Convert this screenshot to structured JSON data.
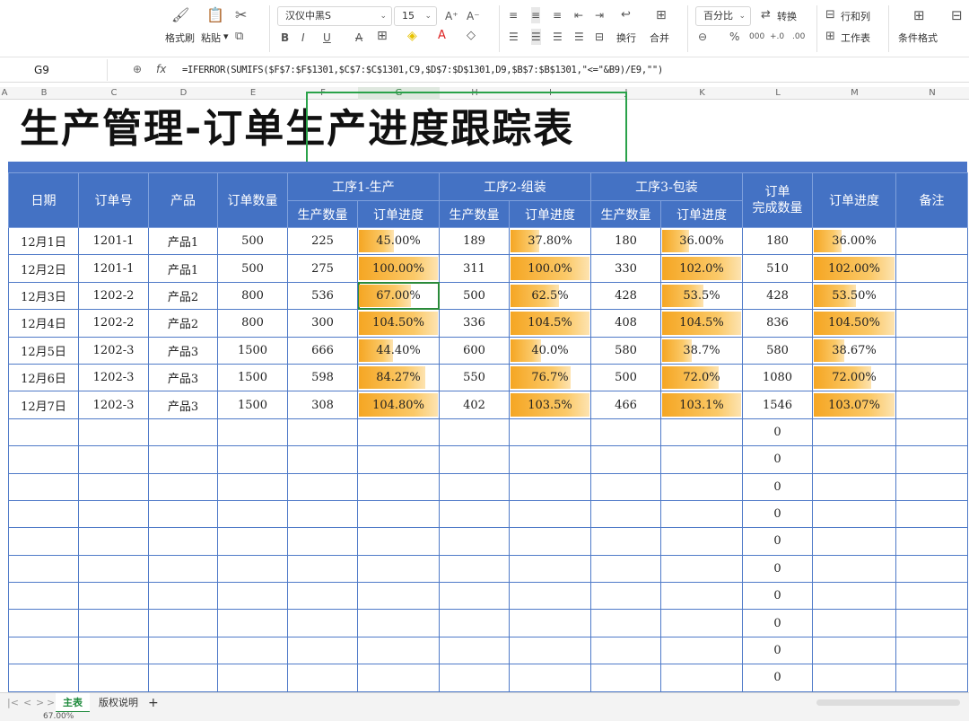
{
  "toolbar": {
    "format_painter": "格式刷",
    "paste": "粘贴",
    "font_name": "汉仪中黑S",
    "font_size": "15",
    "number_format": "百分比",
    "convert": "转换",
    "rows_cols": "行和列",
    "wrap": "换行",
    "merge": "合并",
    "worksheet": "工作表",
    "cond_format": "条件格式"
  },
  "formula_bar": {
    "cell": "G9",
    "fx": "fx",
    "formula": "=IFERROR(SUMIFS($F$7:$F$1301,$C$7:$C$1301,C9,$D$7:$D$1301,D9,$B$7:$B$1301,\"<=\"&B9)/E9,\"\")"
  },
  "columns": [
    "A",
    "B",
    "C",
    "D",
    "E",
    "F",
    "G",
    "H",
    "I",
    "J",
    "K",
    "L",
    "M",
    "N"
  ],
  "title": "生产管理-订单生产进度跟踪表",
  "header": {
    "date": "日期",
    "order_no": "订单号",
    "product": "产品",
    "order_qty": "订单数量",
    "proc1": "工序1-生产",
    "proc2": "工序2-组装",
    "proc3": "工序3-包装",
    "qty": "生产数量",
    "progress": "订单进度",
    "done_qty": "订单\n完成数量",
    "order_progress": "订单进度",
    "remark": "备注"
  },
  "rows": [
    {
      "date": "12月1日",
      "order": "1201-1",
      "product": "产品1",
      "qty": "500",
      "p1q": "225",
      "p1p": "45.00%",
      "p1v": 0.45,
      "p2q": "189",
      "p2p": "37.80%",
      "p2v": 0.378,
      "p3q": "180",
      "p3p": "36.00%",
      "p3v": 0.36,
      "done": "180",
      "op": "36.00%",
      "opv": 0.36
    },
    {
      "date": "12月2日",
      "order": "1201-1",
      "product": "产品1",
      "qty": "500",
      "p1q": "275",
      "p1p": "100.00%",
      "p1v": 1.0,
      "p2q": "311",
      "p2p": "100.0%",
      "p2v": 1.0,
      "p3q": "330",
      "p3p": "102.0%",
      "p3v": 1.02,
      "done": "510",
      "op": "102.00%",
      "opv": 1.02
    },
    {
      "date": "12月3日",
      "order": "1202-2",
      "product": "产品2",
      "qty": "800",
      "p1q": "536",
      "p1p": "67.00%",
      "p1v": 0.67,
      "p2q": "500",
      "p2p": "62.5%",
      "p2v": 0.625,
      "p3q": "428",
      "p3p": "53.5%",
      "p3v": 0.535,
      "done": "428",
      "op": "53.50%",
      "opv": 0.535
    },
    {
      "date": "12月4日",
      "order": "1202-2",
      "product": "产品2",
      "qty": "800",
      "p1q": "300",
      "p1p": "104.50%",
      "p1v": 1.045,
      "p2q": "336",
      "p2p": "104.5%",
      "p2v": 1.045,
      "p3q": "408",
      "p3p": "104.5%",
      "p3v": 1.045,
      "done": "836",
      "op": "104.50%",
      "opv": 1.045
    },
    {
      "date": "12月5日",
      "order": "1202-3",
      "product": "产品3",
      "qty": "1500",
      "p1q": "666",
      "p1p": "44.40%",
      "p1v": 0.444,
      "p2q": "600",
      "p2p": "40.0%",
      "p2v": 0.4,
      "p3q": "580",
      "p3p": "38.7%",
      "p3v": 0.387,
      "done": "580",
      "op": "38.67%",
      "opv": 0.3867
    },
    {
      "date": "12月6日",
      "order": "1202-3",
      "product": "产品3",
      "qty": "1500",
      "p1q": "598",
      "p1p": "84.27%",
      "p1v": 0.8427,
      "p2q": "550",
      "p2p": "76.7%",
      "p2v": 0.767,
      "p3q": "500",
      "p3p": "72.0%",
      "p3v": 0.72,
      "done": "1080",
      "op": "72.00%",
      "opv": 0.72
    },
    {
      "date": "12月7日",
      "order": "1202-3",
      "product": "产品3",
      "qty": "1500",
      "p1q": "308",
      "p1p": "104.80%",
      "p1v": 1.048,
      "p2q": "402",
      "p2p": "103.5%",
      "p2v": 1.035,
      "p3q": "466",
      "p3p": "103.1%",
      "p3v": 1.031,
      "done": "1546",
      "op": "103.07%",
      "opv": 1.0307
    }
  ],
  "empty_rows_done": [
    "0",
    "0",
    "0",
    "0",
    "0",
    "0",
    "0",
    "0",
    "0",
    "0"
  ],
  "sheet_tabs": {
    "main": "主表",
    "copyright": "版权说明",
    "add": "+"
  },
  "status": {
    "value": "67.00%"
  },
  "colors": {
    "header": "#4472c4",
    "bar": "#f5a623",
    "selection": "#2aa24a"
  }
}
